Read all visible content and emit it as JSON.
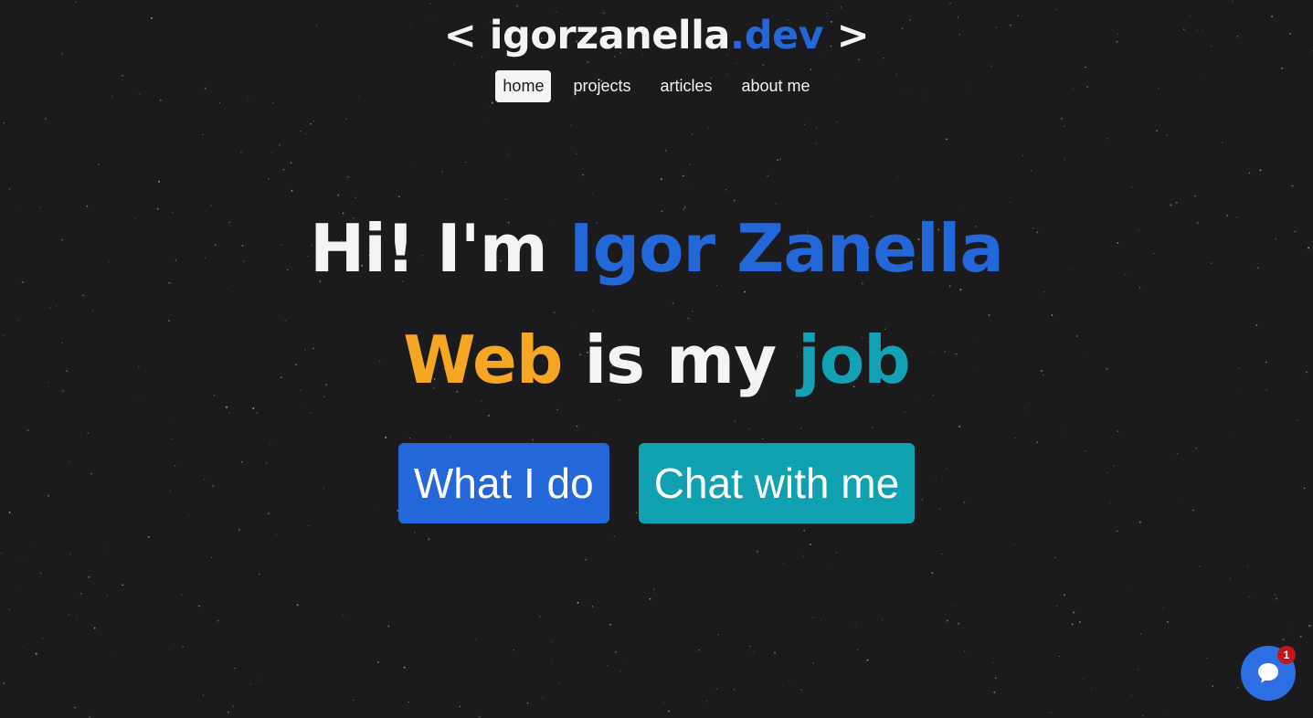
{
  "logo": {
    "prefix": "< igorzanella",
    "accent": ".dev",
    "suffix": " >"
  },
  "nav": {
    "items": [
      {
        "label": "home",
        "active": true
      },
      {
        "label": "projects",
        "active": false
      },
      {
        "label": "articles",
        "active": false
      },
      {
        "label": "about me",
        "active": false
      }
    ]
  },
  "hero": {
    "line1_prefix": "Hi! I'm ",
    "line1_name": "Igor Zanella",
    "line2_word1": "Web",
    "line2_middle": " is my ",
    "line2_word2": "job"
  },
  "cta": {
    "primary_label": "What I do",
    "secondary_label": "Chat with me"
  },
  "chat_widget": {
    "icon": "chat-bubble-icon",
    "badge_count": "1"
  },
  "colors": {
    "background": "#1b1b1d",
    "accent_blue": "#2467d9",
    "accent_orange": "#f5a623",
    "accent_teal": "#12a2b3",
    "badge_red": "#c0171d"
  }
}
